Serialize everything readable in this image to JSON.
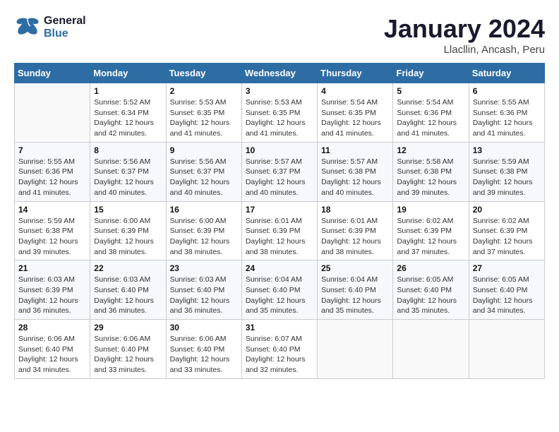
{
  "header": {
    "logo_general": "General",
    "logo_blue": "Blue",
    "month_title": "January 2024",
    "location": "Llacllin, Ancash, Peru"
  },
  "days_of_week": [
    "Sunday",
    "Monday",
    "Tuesday",
    "Wednesday",
    "Thursday",
    "Friday",
    "Saturday"
  ],
  "weeks": [
    [
      {
        "day": "",
        "info": ""
      },
      {
        "day": "1",
        "info": "Sunrise: 5:52 AM\nSunset: 6:34 PM\nDaylight: 12 hours\nand 42 minutes."
      },
      {
        "day": "2",
        "info": "Sunrise: 5:53 AM\nSunset: 6:35 PM\nDaylight: 12 hours\nand 41 minutes."
      },
      {
        "day": "3",
        "info": "Sunrise: 5:53 AM\nSunset: 6:35 PM\nDaylight: 12 hours\nand 41 minutes."
      },
      {
        "day": "4",
        "info": "Sunrise: 5:54 AM\nSunset: 6:35 PM\nDaylight: 12 hours\nand 41 minutes."
      },
      {
        "day": "5",
        "info": "Sunrise: 5:54 AM\nSunset: 6:36 PM\nDaylight: 12 hours\nand 41 minutes."
      },
      {
        "day": "6",
        "info": "Sunrise: 5:55 AM\nSunset: 6:36 PM\nDaylight: 12 hours\nand 41 minutes."
      }
    ],
    [
      {
        "day": "7",
        "info": "Sunrise: 5:55 AM\nSunset: 6:36 PM\nDaylight: 12 hours\nand 41 minutes."
      },
      {
        "day": "8",
        "info": "Sunrise: 5:56 AM\nSunset: 6:37 PM\nDaylight: 12 hours\nand 40 minutes."
      },
      {
        "day": "9",
        "info": "Sunrise: 5:56 AM\nSunset: 6:37 PM\nDaylight: 12 hours\nand 40 minutes."
      },
      {
        "day": "10",
        "info": "Sunrise: 5:57 AM\nSunset: 6:37 PM\nDaylight: 12 hours\nand 40 minutes."
      },
      {
        "day": "11",
        "info": "Sunrise: 5:57 AM\nSunset: 6:38 PM\nDaylight: 12 hours\nand 40 minutes."
      },
      {
        "day": "12",
        "info": "Sunrise: 5:58 AM\nSunset: 6:38 PM\nDaylight: 12 hours\nand 39 minutes."
      },
      {
        "day": "13",
        "info": "Sunrise: 5:59 AM\nSunset: 6:38 PM\nDaylight: 12 hours\nand 39 minutes."
      }
    ],
    [
      {
        "day": "14",
        "info": "Sunrise: 5:59 AM\nSunset: 6:38 PM\nDaylight: 12 hours\nand 39 minutes."
      },
      {
        "day": "15",
        "info": "Sunrise: 6:00 AM\nSunset: 6:39 PM\nDaylight: 12 hours\nand 38 minutes."
      },
      {
        "day": "16",
        "info": "Sunrise: 6:00 AM\nSunset: 6:39 PM\nDaylight: 12 hours\nand 38 minutes."
      },
      {
        "day": "17",
        "info": "Sunrise: 6:01 AM\nSunset: 6:39 PM\nDaylight: 12 hours\nand 38 minutes."
      },
      {
        "day": "18",
        "info": "Sunrise: 6:01 AM\nSunset: 6:39 PM\nDaylight: 12 hours\nand 38 minutes."
      },
      {
        "day": "19",
        "info": "Sunrise: 6:02 AM\nSunset: 6:39 PM\nDaylight: 12 hours\nand 37 minutes."
      },
      {
        "day": "20",
        "info": "Sunrise: 6:02 AM\nSunset: 6:39 PM\nDaylight: 12 hours\nand 37 minutes."
      }
    ],
    [
      {
        "day": "21",
        "info": "Sunrise: 6:03 AM\nSunset: 6:39 PM\nDaylight: 12 hours\nand 36 minutes."
      },
      {
        "day": "22",
        "info": "Sunrise: 6:03 AM\nSunset: 6:40 PM\nDaylight: 12 hours\nand 36 minutes."
      },
      {
        "day": "23",
        "info": "Sunrise: 6:03 AM\nSunset: 6:40 PM\nDaylight: 12 hours\nand 36 minutes."
      },
      {
        "day": "24",
        "info": "Sunrise: 6:04 AM\nSunset: 6:40 PM\nDaylight: 12 hours\nand 35 minutes."
      },
      {
        "day": "25",
        "info": "Sunrise: 6:04 AM\nSunset: 6:40 PM\nDaylight: 12 hours\nand 35 minutes."
      },
      {
        "day": "26",
        "info": "Sunrise: 6:05 AM\nSunset: 6:40 PM\nDaylight: 12 hours\nand 35 minutes."
      },
      {
        "day": "27",
        "info": "Sunrise: 6:05 AM\nSunset: 6:40 PM\nDaylight: 12 hours\nand 34 minutes."
      }
    ],
    [
      {
        "day": "28",
        "info": "Sunrise: 6:06 AM\nSunset: 6:40 PM\nDaylight: 12 hours\nand 34 minutes."
      },
      {
        "day": "29",
        "info": "Sunrise: 6:06 AM\nSunset: 6:40 PM\nDaylight: 12 hours\nand 33 minutes."
      },
      {
        "day": "30",
        "info": "Sunrise: 6:06 AM\nSunset: 6:40 PM\nDaylight: 12 hours\nand 33 minutes."
      },
      {
        "day": "31",
        "info": "Sunrise: 6:07 AM\nSunset: 6:40 PM\nDaylight: 12 hours\nand 32 minutes."
      },
      {
        "day": "",
        "info": ""
      },
      {
        "day": "",
        "info": ""
      },
      {
        "day": "",
        "info": ""
      }
    ]
  ]
}
